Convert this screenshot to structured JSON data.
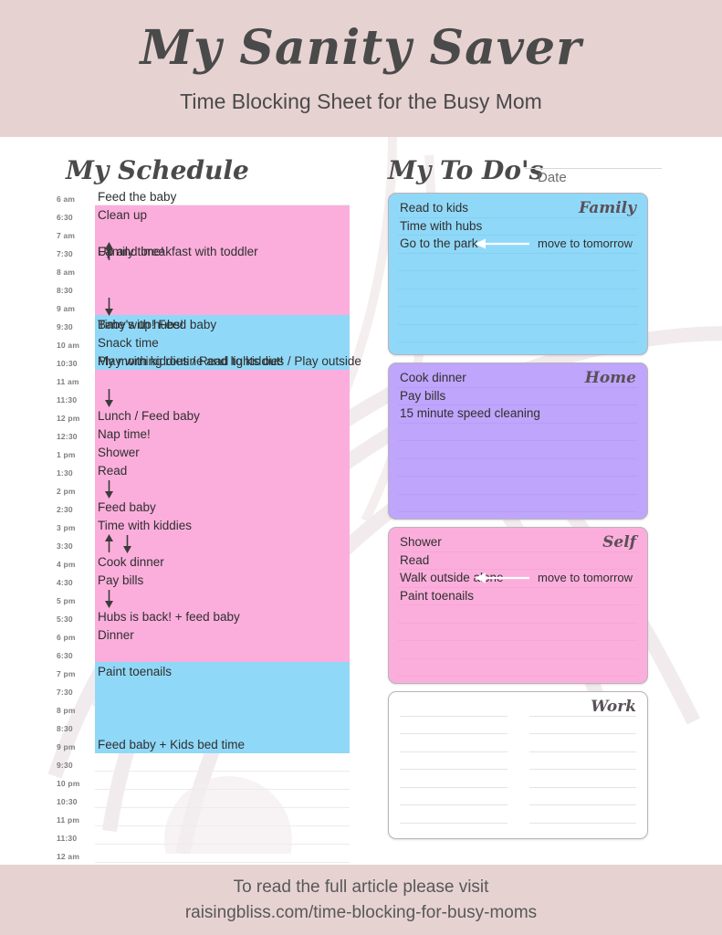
{
  "header": {
    "title": "My Sanity Saver",
    "subtitle": "Time Blocking Sheet for the Busy Mom",
    "background": "#e7d2d2"
  },
  "footer": {
    "line1": "To read the full article please visit",
    "line2": "raisingbliss.com/time-blocking-for-busy-moms",
    "background": "#e7d2d2"
  },
  "schedule": {
    "heading": "My Schedule",
    "start_time": "6 am",
    "end_time": "12 am",
    "row_minutes": 30,
    "times": [
      "6 am",
      "6:30",
      "7 am",
      "7:30",
      "8 am",
      "8:30",
      "9 am",
      "9:30",
      "10 am",
      "10:30",
      "11 am",
      "11:30",
      "12 pm",
      "12:30",
      "1 pm",
      "1:30",
      "2 pm",
      "2:30",
      "3 pm",
      "3:30",
      "4 pm",
      "4:30",
      "5 pm",
      "5:30",
      "6 pm",
      "6:30",
      "7 pm",
      "7:30",
      "8 pm",
      "8:30",
      "9 pm",
      "9:30",
      "10 pm",
      "10:30",
      "11 pm",
      "11:30",
      "12 am"
    ],
    "colors": {
      "blue": "#90d8f8",
      "pink": "#fbaedc",
      "purple": "#bfa5fb",
      "gridline": "#ececec"
    },
    "blocks": [
      {
        "start": "7:30",
        "end": "8:30",
        "color": "blue"
      },
      {
        "start": "10:30",
        "end": "11:30",
        "color": "blue"
      },
      {
        "start": "12:30",
        "end": "1:30",
        "color": "pink"
      },
      {
        "start": "2:30",
        "end": "3 pm",
        "color": "blue"
      },
      {
        "start": "3:30",
        "end": "4:30",
        "color": "purple"
      },
      {
        "start": "5:30",
        "end": "6 pm",
        "color": "blue"
      },
      {
        "start": "6 pm",
        "end": "6:30",
        "color": "purple"
      },
      {
        "start": "6:30",
        "end": "7 pm",
        "color": "pink"
      },
      {
        "start": "7 pm",
        "end": "9 pm",
        "color": "blue"
      },
      {
        "start": "9:30",
        "end": "10:30",
        "color": "blue"
      }
    ],
    "entries": [
      {
        "time": "6 am",
        "text": "Feed the baby"
      },
      {
        "time": "7:30",
        "text": "Up and breakfast with toddler"
      },
      {
        "time": "9:30",
        "text": "Baby's up!  Feed baby"
      },
      {
        "time": "10 am",
        "text": "Snack time"
      },
      {
        "time": "10:30",
        "text": "Play with kiddies / Read to kiddies / Play outside"
      },
      {
        "time": "12 pm",
        "text": "Lunch / Feed baby"
      },
      {
        "time": "12:30",
        "text": "Nap time!"
      },
      {
        "time": "1 pm",
        "text": "Shower"
      },
      {
        "time": "1:30",
        "text": "Read"
      },
      {
        "time": "2:30",
        "text": "Feed baby"
      },
      {
        "time": "3 pm",
        "text": "Time with kiddies"
      },
      {
        "time": "4 pm",
        "text": "Cook dinner"
      },
      {
        "time": "4:30",
        "text": "Pay bills"
      },
      {
        "time": "5:30",
        "text": "Hubs is back!  + feed baby"
      },
      {
        "time": "6 pm",
        "text": "Dinner"
      },
      {
        "time": "6:30",
        "text": "Clean up"
      },
      {
        "time": "7 pm",
        "text": "Paint toenails"
      },
      {
        "time": "7:30",
        "text": "Family time!"
      },
      {
        "time": "9 pm",
        "text": "Feed baby + Kids bed time"
      },
      {
        "time": "9:30",
        "text": "Time with hubs!"
      },
      {
        "time": "10:30",
        "text": "My morning routine and lights out!"
      }
    ],
    "arrows": [
      {
        "direction": "up",
        "column": 1,
        "from": "7 am",
        "to": "7:30"
      },
      {
        "direction": "down",
        "column": 1,
        "from": "8:30",
        "to": "9 am"
      },
      {
        "direction": "down",
        "column": 1,
        "from": "11 am",
        "to": "11:30"
      },
      {
        "direction": "down",
        "column": 1,
        "from": "1:30",
        "to": "2 pm"
      },
      {
        "direction": "up",
        "column": 1,
        "from": "3 pm",
        "to": "3:30"
      },
      {
        "direction": "down",
        "column": 2,
        "from": "3 pm",
        "to": "3:30"
      },
      {
        "direction": "down",
        "column": 1,
        "from": "4:30",
        "to": "5 pm"
      }
    ]
  },
  "todo": {
    "heading": "My To Do's",
    "date_label": "Date",
    "date_value": "",
    "cards": [
      {
        "label": "Family",
        "color": "#90d8f8",
        "rule_color": "#6fc4e8",
        "items": [
          "Read to kids",
          "Time with hubs",
          "Go to the park"
        ],
        "note": {
          "text": "move to tomorrow",
          "points_to": "Go to the park",
          "arrow_color": "#ffffff"
        }
      },
      {
        "label": "Home",
        "color": "#bfa5fb",
        "rule_color": "#a98ef0",
        "items": [
          "Cook dinner",
          "Pay bills",
          "15 minute speed cleaning"
        ],
        "note": null
      },
      {
        "label": "Self",
        "color": "#fbaedc",
        "rule_color": "#f096c8",
        "items": [
          "Shower",
          "Read",
          "Walk outside alone",
          "Paint toenails"
        ],
        "note": {
          "text": "move to tomorrow",
          "points_to": "Walk outside alone",
          "arrow_color": "#ffffff"
        }
      },
      {
        "label": "Work",
        "color": "#ffffff",
        "rule_color": "#e4e4e4",
        "items": [],
        "note": null,
        "two_columns": true
      }
    ]
  }
}
